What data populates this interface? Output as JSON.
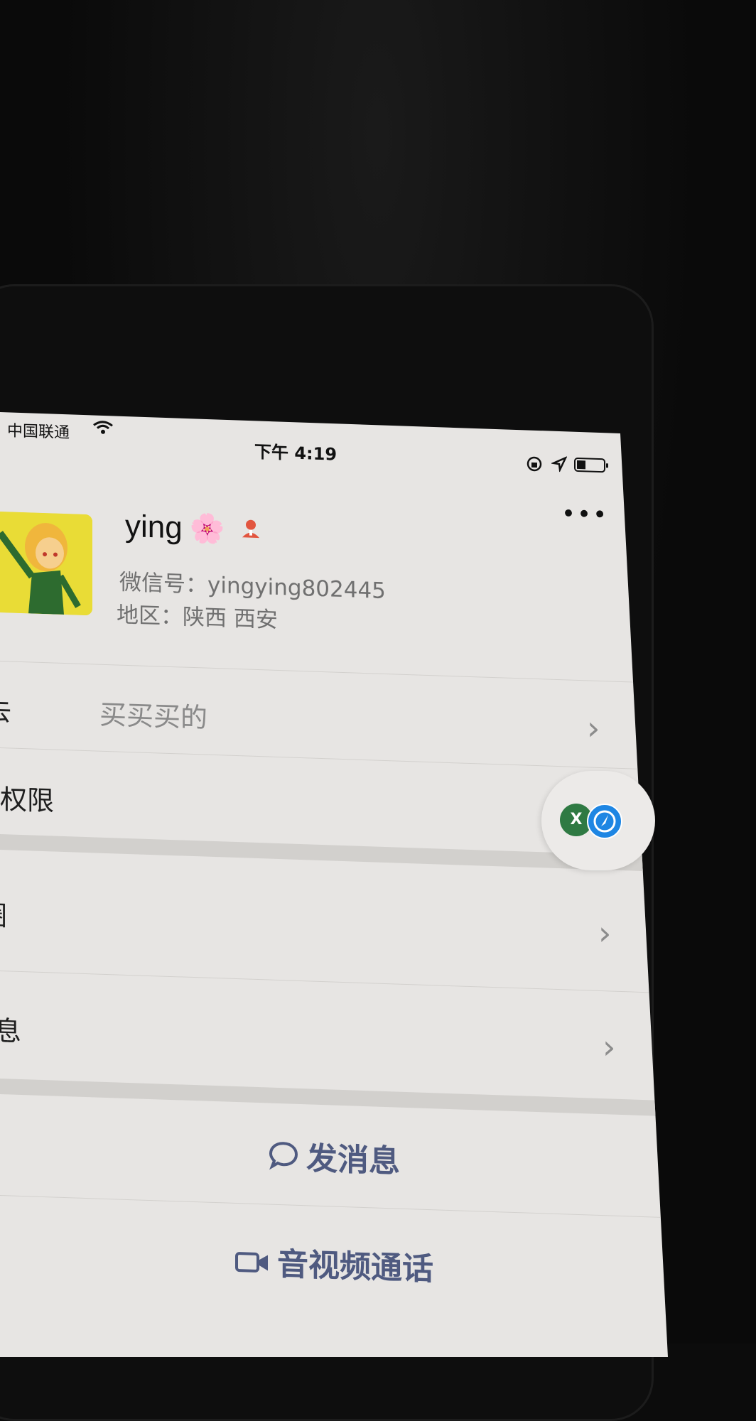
{
  "status_bar": {
    "carrier": "中国联通",
    "time": "下午 4:19"
  },
  "profile": {
    "nickname": "ying",
    "nickname_emoji": "🌸",
    "wechat_id": "微信号：yingying802445",
    "region": "地区：陕西 西安"
  },
  "rows": {
    "remark_label": "去",
    "remark_value": "买买买的",
    "permissions_label": "权限",
    "moments_label": "圈",
    "more_info_label": "息"
  },
  "actions": {
    "send_message": "发消息",
    "call": "音视频通话"
  },
  "floating_widget": {
    "badge_letter": "X"
  },
  "colors": {
    "screen_bg": "#e7e5e3",
    "action_text": "#4f5a80",
    "secondary_text": "#707070"
  }
}
